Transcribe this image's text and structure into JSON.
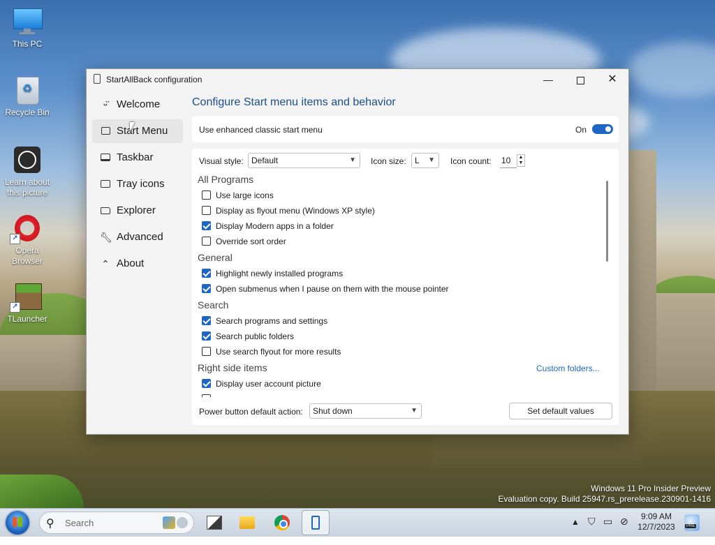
{
  "desktop": {
    "icons": [
      {
        "label": "This PC"
      },
      {
        "label": "Recycle Bin"
      },
      {
        "label": "Learn about this picture"
      },
      {
        "label": "Opera Browser"
      },
      {
        "label": "TLauncher"
      }
    ],
    "watermark": {
      "line1": "Windows 11 Pro Insider Preview",
      "line2": "Evaluation copy. Build 25947.rs_prerelease.230901-1416"
    }
  },
  "window": {
    "title": "StartAllBack configuration",
    "nav": [
      {
        "label": "Welcome",
        "icon": "smile-icon"
      },
      {
        "label": "Start Menu",
        "icon": "start-menu-icon"
      },
      {
        "label": "Taskbar",
        "icon": "taskbar-icon"
      },
      {
        "label": "Tray icons",
        "icon": "tray-icon"
      },
      {
        "label": "Explorer",
        "icon": "folder-icon"
      },
      {
        "label": "Advanced",
        "icon": "wrench-icon"
      },
      {
        "label": "About",
        "icon": "about-icon"
      }
    ],
    "heading": "Configure Start menu items and behavior",
    "enhanced": {
      "label": "Use enhanced classic start menu",
      "state": "On",
      "on": true
    },
    "visual_style": {
      "label": "Visual style:",
      "value": "Default"
    },
    "icon_size": {
      "label": "Icon size:",
      "value": "L"
    },
    "icon_count": {
      "label": "Icon count:",
      "value": "10"
    },
    "sections": {
      "all_programs": {
        "title": "All Programs",
        "items": [
          {
            "label": "Use large icons",
            "checked": false
          },
          {
            "label": "Display as flyout menu (Windows XP style)",
            "checked": false
          },
          {
            "label": "Display Modern apps in a folder",
            "checked": true
          },
          {
            "label": "Override sort order",
            "checked": false
          }
        ]
      },
      "general": {
        "title": "General",
        "items": [
          {
            "label": "Highlight newly installed programs",
            "checked": true
          },
          {
            "label": "Open submenus when I pause on them with the mouse pointer",
            "checked": true
          }
        ]
      },
      "search": {
        "title": "Search",
        "items": [
          {
            "label": "Search programs and settings",
            "checked": true
          },
          {
            "label": "Search public folders",
            "checked": true
          },
          {
            "label": "Use search flyout for more results",
            "checked": false
          }
        ]
      },
      "right_side": {
        "title": "Right side items",
        "link": "Custom folders...",
        "items": [
          {
            "label": "Display user account picture",
            "checked": true
          }
        ]
      }
    },
    "power": {
      "label": "Power button default action:",
      "value": "Shut down"
    },
    "default_button": "Set default values"
  },
  "taskbar": {
    "search_placeholder": "Search",
    "clock_time": "9:09 AM",
    "clock_date": "12/7/2023",
    "badge": "PRE"
  }
}
